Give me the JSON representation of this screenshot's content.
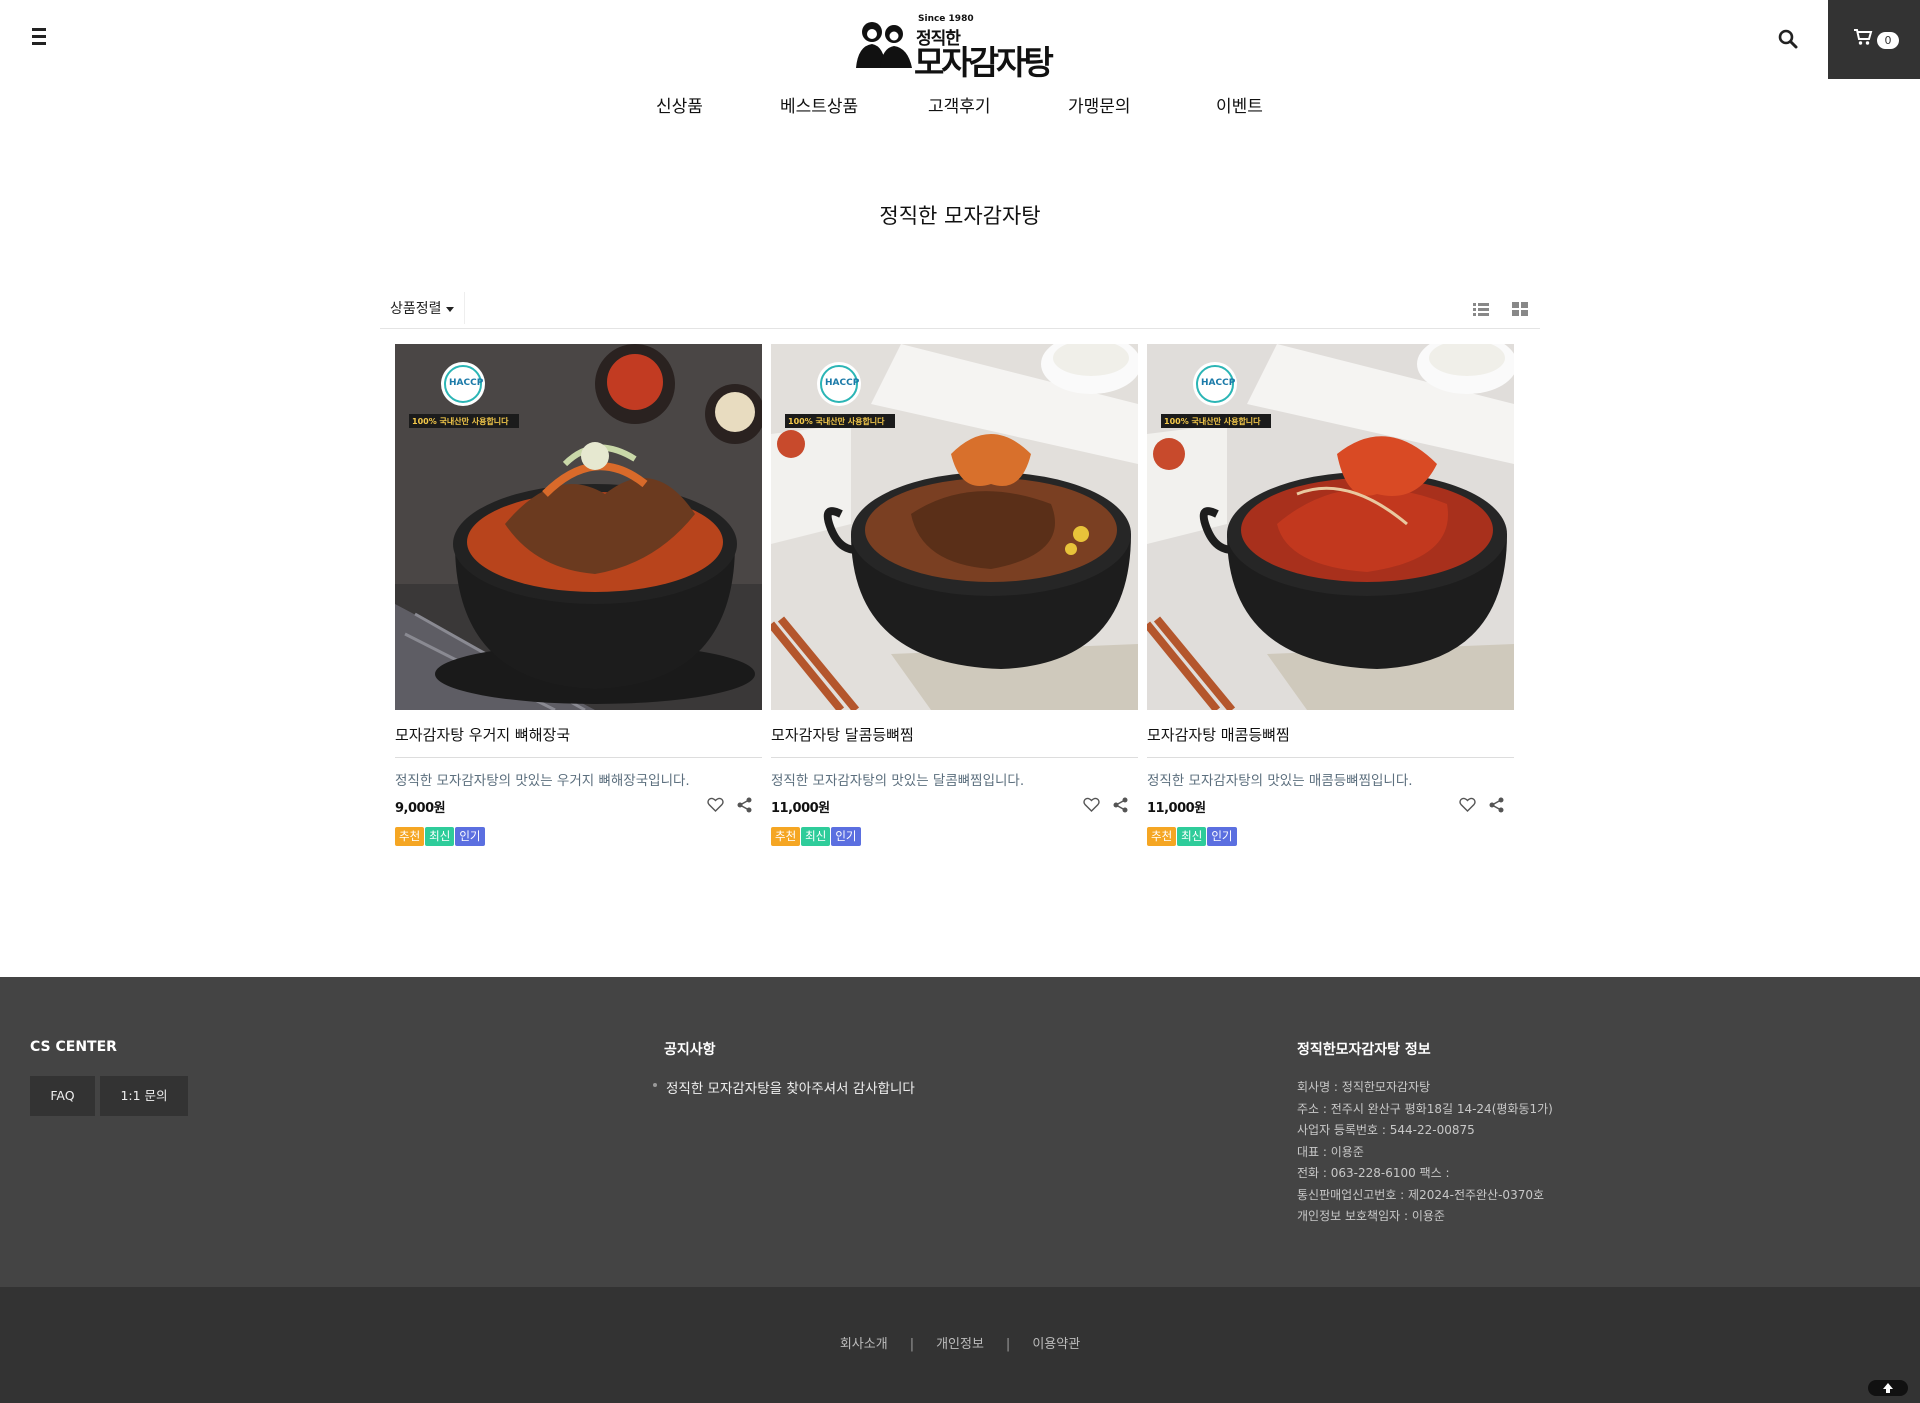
{
  "header": {
    "logo": {
      "since": "Since 1980",
      "small": "정직한",
      "big": "모자감자탕"
    },
    "cart_count": "0"
  },
  "nav": [
    {
      "label": "신상품"
    },
    {
      "label": "베스트상품"
    },
    {
      "label": "고객후기"
    },
    {
      "label": "가맹문의"
    },
    {
      "label": "이벤트"
    }
  ],
  "page_title": "정직한 모자감자탕",
  "sort": {
    "label": "상품정렬"
  },
  "products": [
    {
      "name": "모자감자탕 우거지 뼈해장국",
      "desc": "정직한 모자감자탕의 맛있는 우거지 뼈해장국입니다.",
      "price": "9,000원",
      "image_overlay": {
        "haccp": "HACCP",
        "banner": "100% 국내산만 사용합니다"
      },
      "badges": [
        "추천",
        "최신",
        "인기"
      ]
    },
    {
      "name": "모자감자탕 달콤등뼈찜",
      "desc": "정직한 모자감자탕의 맛있는 달콤뼈찜입니다.",
      "price": "11,000원",
      "image_overlay": {
        "haccp": "HACCP",
        "banner": "100% 국내산만 사용합니다"
      },
      "badges": [
        "추천",
        "최신",
        "인기"
      ]
    },
    {
      "name": "모자감자탕 매콤등뼈찜",
      "desc": "정직한 모자감자탕의 맛있는 매콤등뼈찜입니다.",
      "price": "11,000원",
      "image_overlay": {
        "haccp": "HACCP",
        "banner": "100% 국내산만 사용합니다"
      },
      "badges": [
        "추천",
        "최신",
        "인기"
      ]
    }
  ],
  "badge_colors": {
    "추천": "#f5a623",
    "최신": "#2ecc9a",
    "인기": "#5b6fe0"
  },
  "footer": {
    "cs_title": "CS CENTER",
    "cs_buttons": [
      "FAQ",
      "1:1 문의"
    ],
    "notice_title": "공지사항",
    "notice_items": [
      "정직한 모자감자탕을 찾아주셔서 감사합니다"
    ],
    "info_title": "정직한모자감자탕 정보",
    "info_lines": [
      "회사명 : 정직한모자감자탕",
      "주소 : 전주시 완산구 평화18길 14-24(평화동1가)",
      "사업자 등록번호 : 544-22-00875",
      "대표 : 이용준",
      "전화 : 063-228-6100 팩스 :",
      "통신판매업신고번호 : 제2024-전주완산-0370호",
      "개인정보 보호책임자 : 이용준"
    ]
  },
  "bottom_links": [
    "회사소개",
    "개인정보",
    "이용약관"
  ],
  "icons": {
    "menu": "hamburger-icon",
    "search": "search-icon",
    "cart": "cart-icon",
    "list_view": "list-view-icon",
    "grid_view": "grid-view-icon",
    "wish": "heart-icon",
    "share": "share-icon",
    "top": "arrow-up-icon"
  }
}
